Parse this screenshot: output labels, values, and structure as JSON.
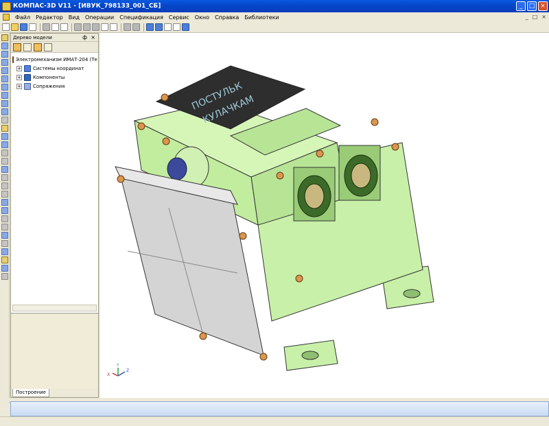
{
  "window": {
    "title": "КОМПАС-3D V11 - [ИВУК_798133_001_СБ]",
    "buttons": {
      "minimize": "_",
      "maximize": "□",
      "close": "×"
    }
  },
  "menu": {
    "items": [
      "Файл",
      "Редактор",
      "Вид",
      "Операции",
      "Спецификация",
      "Сервис",
      "Окно",
      "Справка",
      "Библиотеки"
    ]
  },
  "tree_panel": {
    "title": "Дерево модели",
    "pin": "ф",
    "close": "×",
    "root": "Электромеханизм ИМАТ-204 (Те",
    "items": [
      "Системы координат",
      "Компоненты",
      "Сопряжения"
    ],
    "toggle": "+",
    "tab": "Построение"
  },
  "model": {
    "engraving_line1": "ПОСТУЛЬК",
    "engraving_line2": "КУЛАЧКАМ",
    "colors": {
      "body": "#c8f0a8",
      "body_dark": "#9acc78",
      "cover": "#d4d4d4",
      "plate": "#2e2e2e",
      "connector": "#3c6a28",
      "screw": "#d89650"
    }
  },
  "axis_triad": {
    "x": "X",
    "y": "Y",
    "z": "Z"
  }
}
